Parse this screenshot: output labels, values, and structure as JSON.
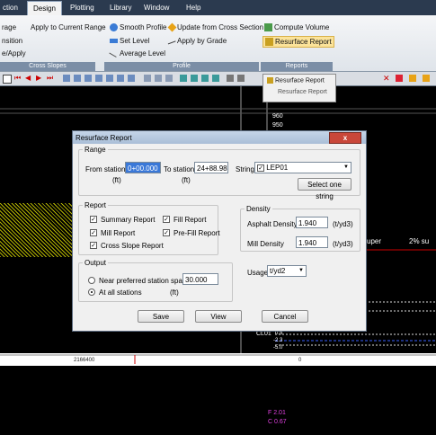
{
  "menu": {
    "tabs": [
      "ction",
      "Design",
      "Plotting",
      "Library",
      "Window",
      "Help"
    ]
  },
  "ribbon": {
    "left_items": [
      "rage",
      "nsition",
      "e/Apply"
    ],
    "apply_current": "Apply to Current Range",
    "cross_slopes": "Cross Slopes",
    "smooth_profile": "Smooth Profile",
    "update_cross": "Update from Cross Section",
    "set_level": "Set Level",
    "apply_grade": "Apply by Grade",
    "average_level": "Average Level",
    "profile": "Profile",
    "compute_volume": "Compute Volume",
    "resurface_report": "Resurface Report",
    "reports": "Reports"
  },
  "dropdown_menu": {
    "item1": "Resurface Report",
    "item2": "Resurface Report"
  },
  "canvas": {
    "val960": "960",
    "val950": "950",
    "super": "uper",
    "pct": "2% su",
    "cl01": "CL01",
    "v05": "0.5",
    "v23": "-2.3",
    "v50": "-5.0",
    "station": "2166400",
    "zero": "0",
    "f201": "F 2.01",
    "c067": "C 0.67"
  },
  "dialog": {
    "title": "Resurface Report",
    "close": "x",
    "range_legend": "Range",
    "from_station_label": "From station",
    "from_station_value": "0+00.000",
    "to_station_label": "To station",
    "to_station_value": "24+88.981",
    "ft": "(ft)",
    "string_label": "String",
    "string_value": "LEP01",
    "select_one_string": "Select one string",
    "report_legend": "Report",
    "summary_report": "Summary Report",
    "fill_report": "Fill Report",
    "mill_report": "Mill Report",
    "prefill_report": "Pre-Fill Report",
    "cross_slope_report": "Cross Slope Report",
    "density_legend": "Density",
    "asphalt_density_label": "Asphalt Density",
    "asphalt_density_value": "1.940",
    "mill_density_label": "Mill Density",
    "mill_density_value": "1.940",
    "density_unit": "(t/yd3)",
    "output_legend": "Output",
    "near_spacing": "Near preferred station spacing",
    "spacing_value": "30.000",
    "all_stations": "At all stations",
    "usage_label": "Usage",
    "usage_value": "t/yd2",
    "save": "Save",
    "view": "View",
    "cancel": "Cancel"
  },
  "colors": {
    "accent_title": "#a9bed7",
    "close_red": "#c9473a",
    "hatch": "#b5b500"
  }
}
